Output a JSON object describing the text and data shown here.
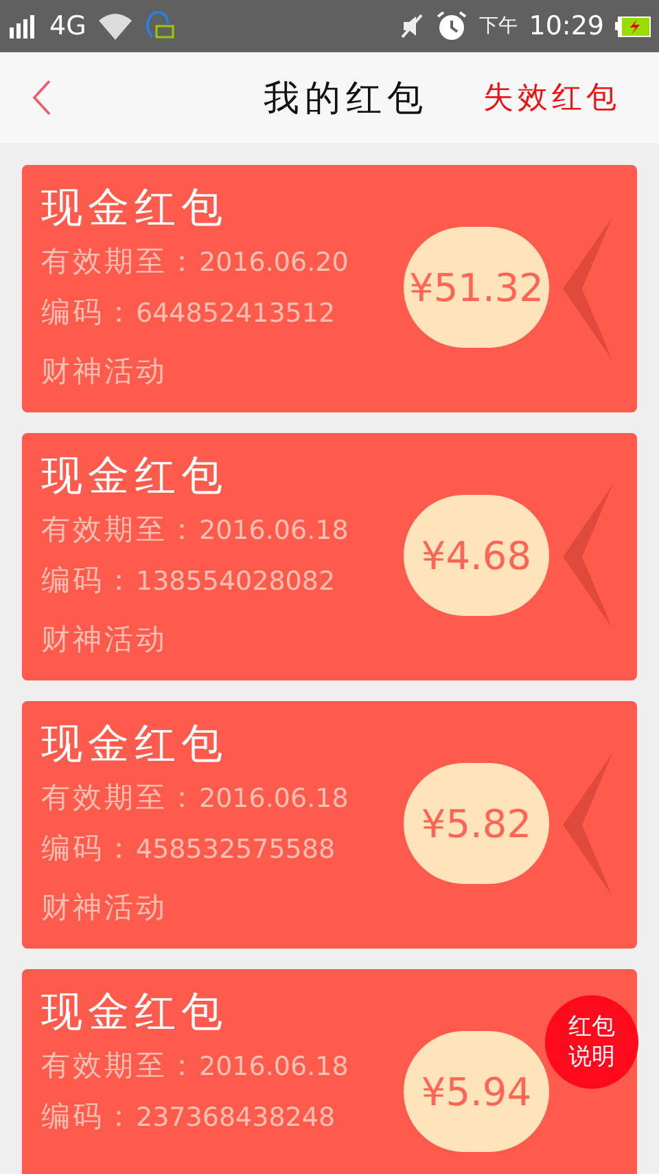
{
  "status_bar": {
    "network": "4G",
    "period": "下午",
    "time": "10:29"
  },
  "header": {
    "title": "我的红包",
    "action": "失效红包"
  },
  "cards": [
    {
      "title": "现金红包",
      "expiry_label": "有效期至：",
      "expiry": "2016.06.20",
      "code_label": "编码：",
      "code": "644852413512",
      "source": "财神活动",
      "amount": "¥51.32"
    },
    {
      "title": "现金红包",
      "expiry_label": "有效期至：",
      "expiry": "2016.06.18",
      "code_label": "编码：",
      "code": "138554028082",
      "source": "财神活动",
      "amount": "¥4.68"
    },
    {
      "title": "现金红包",
      "expiry_label": "有效期至：",
      "expiry": "2016.06.18",
      "code_label": "编码：",
      "code": "458532575588",
      "source": "财神活动",
      "amount": "¥5.82"
    },
    {
      "title": "现金红包",
      "expiry_label": "有效期至：",
      "expiry": "2016.06.18",
      "code_label": "编码：",
      "code": "237368438248",
      "amount": "¥5.94"
    }
  ],
  "help_button": {
    "line1": "红包",
    "line2": "说明"
  }
}
